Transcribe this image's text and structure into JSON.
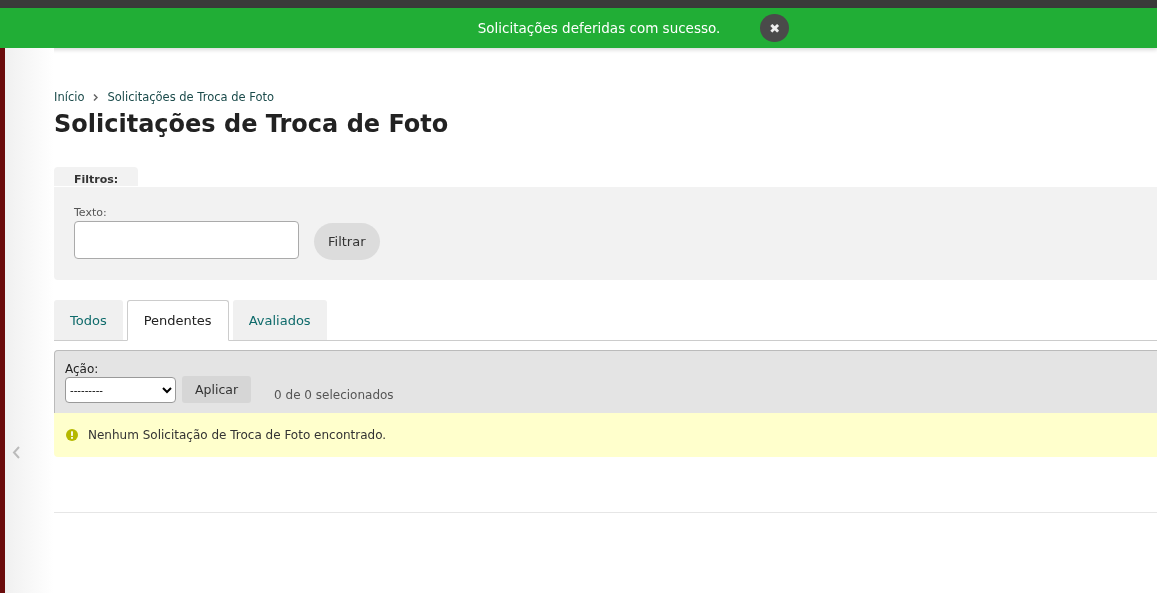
{
  "notification": {
    "message": "Solicitações deferidas com sucesso.",
    "close": "✖"
  },
  "breadcrumb": [
    "Início",
    "Solicitações de Troca de Foto"
  ],
  "title": "Solicitações de Troca de Foto",
  "filters": {
    "tab": "Filtros:",
    "label": "Texto:",
    "button": "Filtrar"
  },
  "tabs": [
    {
      "label": "Todos",
      "selected": false
    },
    {
      "label": "Pendentes",
      "selected": true
    },
    {
      "label": "Avaliados",
      "selected": false
    }
  ],
  "actions": {
    "label": "Ação:",
    "select": "---------",
    "button": "Aplicar",
    "counter": "0 de 0 selecionados"
  },
  "empty_message": "Nenhum Solicitação de Troca de Foto encontrado."
}
